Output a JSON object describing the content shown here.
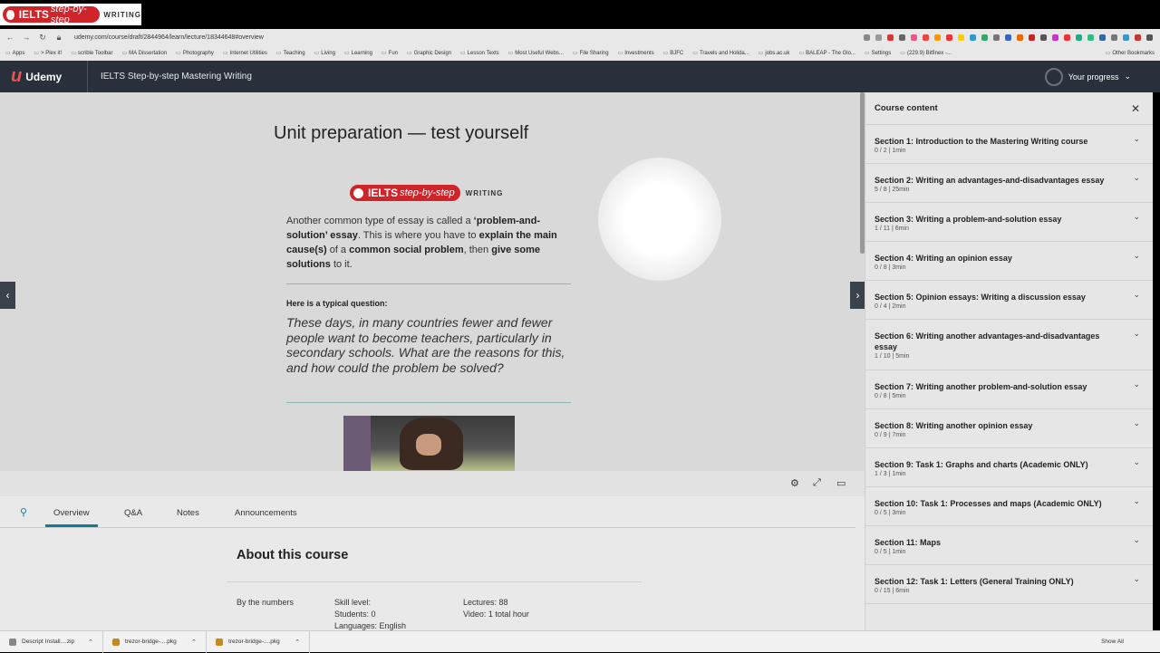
{
  "overlay": {
    "logo_main": "IELTS",
    "logo_sub": "step-by-step",
    "logo_tag": "WRITING"
  },
  "browser": {
    "url": "udemy.com/course/draft/2844964/learn/lecture/18344648#overview",
    "bookmarks": [
      "Apps",
      "> Plex it!",
      "scrible Toolbar",
      "MA Dissertation",
      "Photography",
      "Internet Utilities",
      "Teaching",
      "Living",
      "Learning",
      "Fun",
      "Graphic Design",
      "Lesson Texts",
      "Most Useful Webs...",
      "File Sharing",
      "Investments",
      "BJFC",
      "Travels and Holida...",
      "jobs.ac.uk",
      "BALEAP - The Glo...",
      "Settings",
      "(229.9) Bitfinex -..."
    ],
    "other_bookmarks": "Other Bookmarks"
  },
  "header": {
    "brand": "Udemy",
    "course_title": "IELTS Step-by-step Mastering Writing",
    "progress_label": "Your progress"
  },
  "slide": {
    "title": "Unit preparation — test yourself",
    "logo_main": "IELTS",
    "logo_sub": "step-by-step",
    "logo_tag": "WRITING",
    "p1_a": "Another common type of essay is called a ",
    "p1_b": "‘problem-and-solution’ essay",
    "p1_c": ". This is where you have to ",
    "p1_d": "explain the main cause(s)",
    "p1_e": " of a ",
    "p1_f": "common social problem",
    "p1_g": ", then ",
    "p1_h": "give some solutions",
    "p1_i": " to it.",
    "question_label": "Here is a typical question:",
    "question_text": "These days, in many countries fewer and fewer people want to become teachers, particularly in secondary schools. What are the reasons for this, and how could the problem be solved?"
  },
  "tabs": [
    "Overview",
    "Q&A",
    "Notes",
    "Announcements"
  ],
  "about": {
    "title": "About this course",
    "by_numbers": "By the numbers",
    "skill_level": "Skill level:",
    "students": "Students: 0",
    "languages": "Languages: English",
    "lectures": "Lectures: 88",
    "video": "Video: 1 total hour"
  },
  "sidebar": {
    "title": "Course content",
    "sections": [
      {
        "title": "Section 1: Introduction to the Mastering Writing course",
        "meta": "0 / 2 | 1min"
      },
      {
        "title": "Section 2: Writing an advantages-and-disadvantages essay",
        "meta": "5 / 8 | 25min"
      },
      {
        "title": "Section 3: Writing a problem-and-solution essay",
        "meta": "1 / 11 | 6min"
      },
      {
        "title": "Section 4: Writing an opinion essay",
        "meta": "0 / 8 | 3min"
      },
      {
        "title": "Section 5: Opinion essays: Writing a discussion essay",
        "meta": "0 / 4 | 2min"
      },
      {
        "title": "Section 6: Writing another advantages-and-disadvantages essay",
        "meta": "1 / 10 | 5min"
      },
      {
        "title": "Section 7: Writing another problem-and-solution essay",
        "meta": "0 / 8 | 5min"
      },
      {
        "title": "Section 8: Writing another opinion essay",
        "meta": "0 / 9 | 7min"
      },
      {
        "title": "Section 9: Task 1: Graphs and charts (Academic ONLY)",
        "meta": "1 / 3 | 1min"
      },
      {
        "title": "Section 10: Task 1: Processes and maps (Academic ONLY)",
        "meta": "0 / 5 | 3min"
      },
      {
        "title": "Section 11: Maps",
        "meta": "0 / 5 | 1min"
      },
      {
        "title": "Section 12: Task 1: Letters (General Training ONLY)",
        "meta": "0 / 15 | 6min"
      }
    ]
  },
  "downloads": [
    {
      "name": "Descript Install....zip"
    },
    {
      "name": "trezor-bridge-....pkg"
    },
    {
      "name": "trezor-bridge-....pkg"
    }
  ],
  "show_all": "Show All"
}
